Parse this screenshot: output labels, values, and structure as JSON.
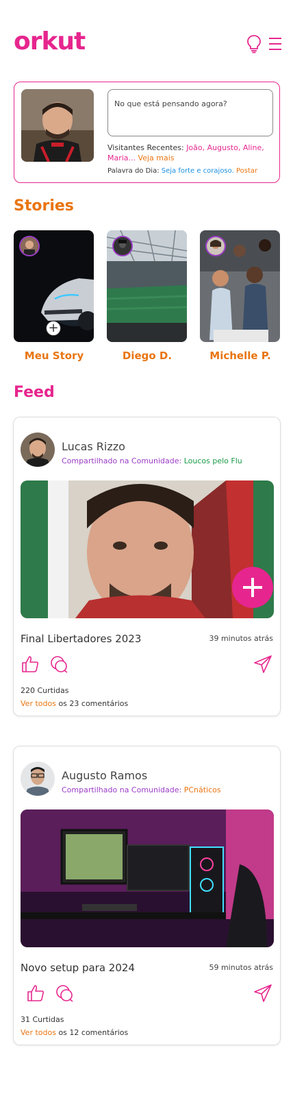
{
  "app": {
    "logo": "orkut"
  },
  "header": {
    "icons": [
      "lightbulb-icon",
      "hamburger-menu-icon"
    ]
  },
  "profile": {
    "thought_placeholder": "No que está pensando agora?",
    "visitors_label": "Visitantes Recentes:",
    "visitors_names": "João, Augusto, Aline, Maria...",
    "visitors_more": "Veja mais",
    "word_label": "Palavra do Dia:",
    "word_text": "Seja forte e corajoso.",
    "word_action": "Postar"
  },
  "stories": {
    "title": "Stories",
    "items": [
      {
        "name": "Meu Story"
      },
      {
        "name": "Diego D."
      },
      {
        "name": "Michelle P."
      }
    ]
  },
  "feed": {
    "title": "Feed",
    "posts": [
      {
        "author": "Lucas Rizzo",
        "shared_label": "Compartilhado na Comunidade:",
        "community": "Loucos pelo Flu",
        "title": "Final Libertadores 2023",
        "time": "39 minutos atrás",
        "likes": "220 Curtidas",
        "see_all": "Ver todos",
        "comments": "os 23 comentários"
      },
      {
        "author": "Augusto Ramos",
        "shared_label": "Compartilhado na Comunidade:",
        "community": "PCnáticos",
        "title": "Novo setup para 2024",
        "time": "59 minutos atrás",
        "likes": "31 Curtidas",
        "see_all": "Ver todos",
        "comments": "os 12 comentários"
      }
    ]
  },
  "colors": {
    "brand_pink": "#e6268e",
    "accent_orange": "#e97511",
    "link_blue": "#1a8fe0",
    "community_green": "#1a9a48",
    "community_purple": "#9a3cc6"
  }
}
